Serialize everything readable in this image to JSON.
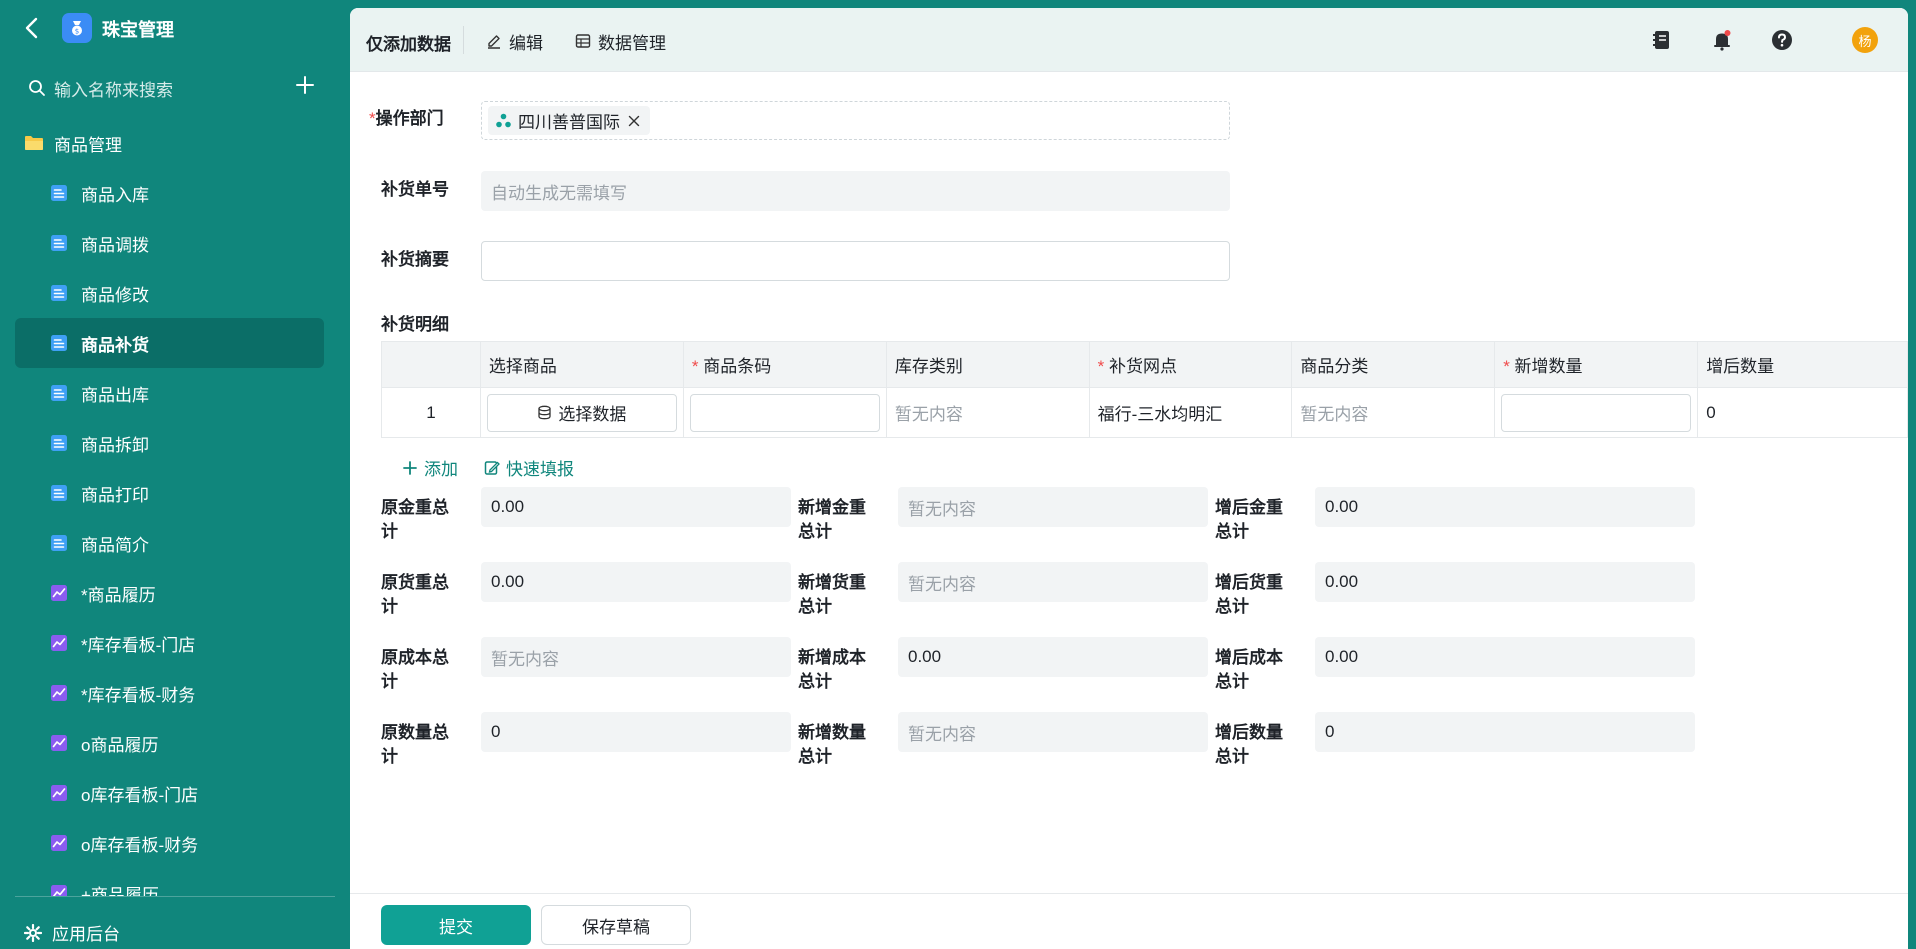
{
  "app": {
    "title": "珠宝管理",
    "search_placeholder": "输入名称来搜索",
    "accent_color": "#10867c"
  },
  "sidebar": {
    "folder_label": "商品管理",
    "items": [
      {
        "label": "商品入库",
        "icon": "doc-icon"
      },
      {
        "label": "商品调拨",
        "icon": "doc-icon"
      },
      {
        "label": "商品修改",
        "icon": "doc-icon"
      },
      {
        "label": "商品补货",
        "icon": "doc-icon",
        "active": true
      },
      {
        "label": "商品出库",
        "icon": "doc-icon"
      },
      {
        "label": "商品拆卸",
        "icon": "doc-icon"
      },
      {
        "label": "商品打印",
        "icon": "doc-icon"
      },
      {
        "label": "商品简介",
        "icon": "doc-icon"
      },
      {
        "label": "*商品履历",
        "icon": "chart-icon"
      },
      {
        "label": "*库存看板-门店",
        "icon": "chart-icon"
      },
      {
        "label": "*库存看板-财务",
        "icon": "chart-icon"
      },
      {
        "label": "o商品履历",
        "icon": "chart-icon"
      },
      {
        "label": "o库存看板-门店",
        "icon": "chart-icon"
      },
      {
        "label": "o库存看板-财务",
        "icon": "chart-icon"
      },
      {
        "label": "+商品履历",
        "icon": "chart-icon"
      }
    ],
    "footer_label": "应用后台"
  },
  "topbar": {
    "title": "仅添加数据",
    "edit_label": "编辑",
    "data_manage_label": "数据管理",
    "avatar_text": "杨"
  },
  "form": {
    "dept_label": "操作部门",
    "dept_value": "四川善普国际",
    "order_no_label": "补货单号",
    "order_no_placeholder": "自动生成无需填写",
    "summary_label": "补货摘要",
    "summary_value": "",
    "detail_label": "补货明细"
  },
  "table": {
    "columns": [
      "",
      "选择商品",
      "商品条码",
      "库存类别",
      "补货网点",
      "商品分类",
      "新增数量",
      "增后数量"
    ],
    "required": [
      false,
      false,
      true,
      false,
      true,
      false,
      true,
      false
    ],
    "rows": [
      {
        "index": "1",
        "select_btn": "选择数据",
        "barcode": "",
        "stock_type": "暂无内容",
        "outlet": "福行-三水均明汇",
        "category": "暂无内容",
        "add_qty": "",
        "after_qty": "0"
      }
    ],
    "add_label": "添加",
    "quick_fill_label": "快速填报"
  },
  "totals": {
    "rows": [
      [
        {
          "label_1": "原金重总",
          "label_2": "计",
          "value": "0.00",
          "empty": false
        },
        {
          "label_1": "新增金重",
          "label_2": "总计",
          "value": "暂无内容",
          "empty": true
        },
        {
          "label_1": "增后金重",
          "label_2": "总计",
          "value": "0.00",
          "empty": false
        }
      ],
      [
        {
          "label_1": "原货重总",
          "label_2": "计",
          "value": "0.00",
          "empty": false
        },
        {
          "label_1": "新增货重",
          "label_2": "总计",
          "value": "暂无内容",
          "empty": true
        },
        {
          "label_1": "增后货重",
          "label_2": "总计",
          "value": "0.00",
          "empty": false
        }
      ],
      [
        {
          "label_1": "原成本总",
          "label_2": "计",
          "value": "暂无内容",
          "empty": true
        },
        {
          "label_1": "新增成本",
          "label_2": "总计",
          "value": "0.00",
          "empty": false
        },
        {
          "label_1": "增后成本",
          "label_2": "总计",
          "value": "0.00",
          "empty": false
        }
      ],
      [
        {
          "label_1": "原数量总",
          "label_2": "计",
          "value": "0",
          "empty": false
        },
        {
          "label_1": "新增数量",
          "label_2": "总计",
          "value": "暂无内容",
          "empty": true
        },
        {
          "label_1": "增后数量",
          "label_2": "总计",
          "value": "0",
          "empty": false
        }
      ]
    ]
  },
  "actions": {
    "submit_label": "提交",
    "draft_label": "保存草稿"
  }
}
